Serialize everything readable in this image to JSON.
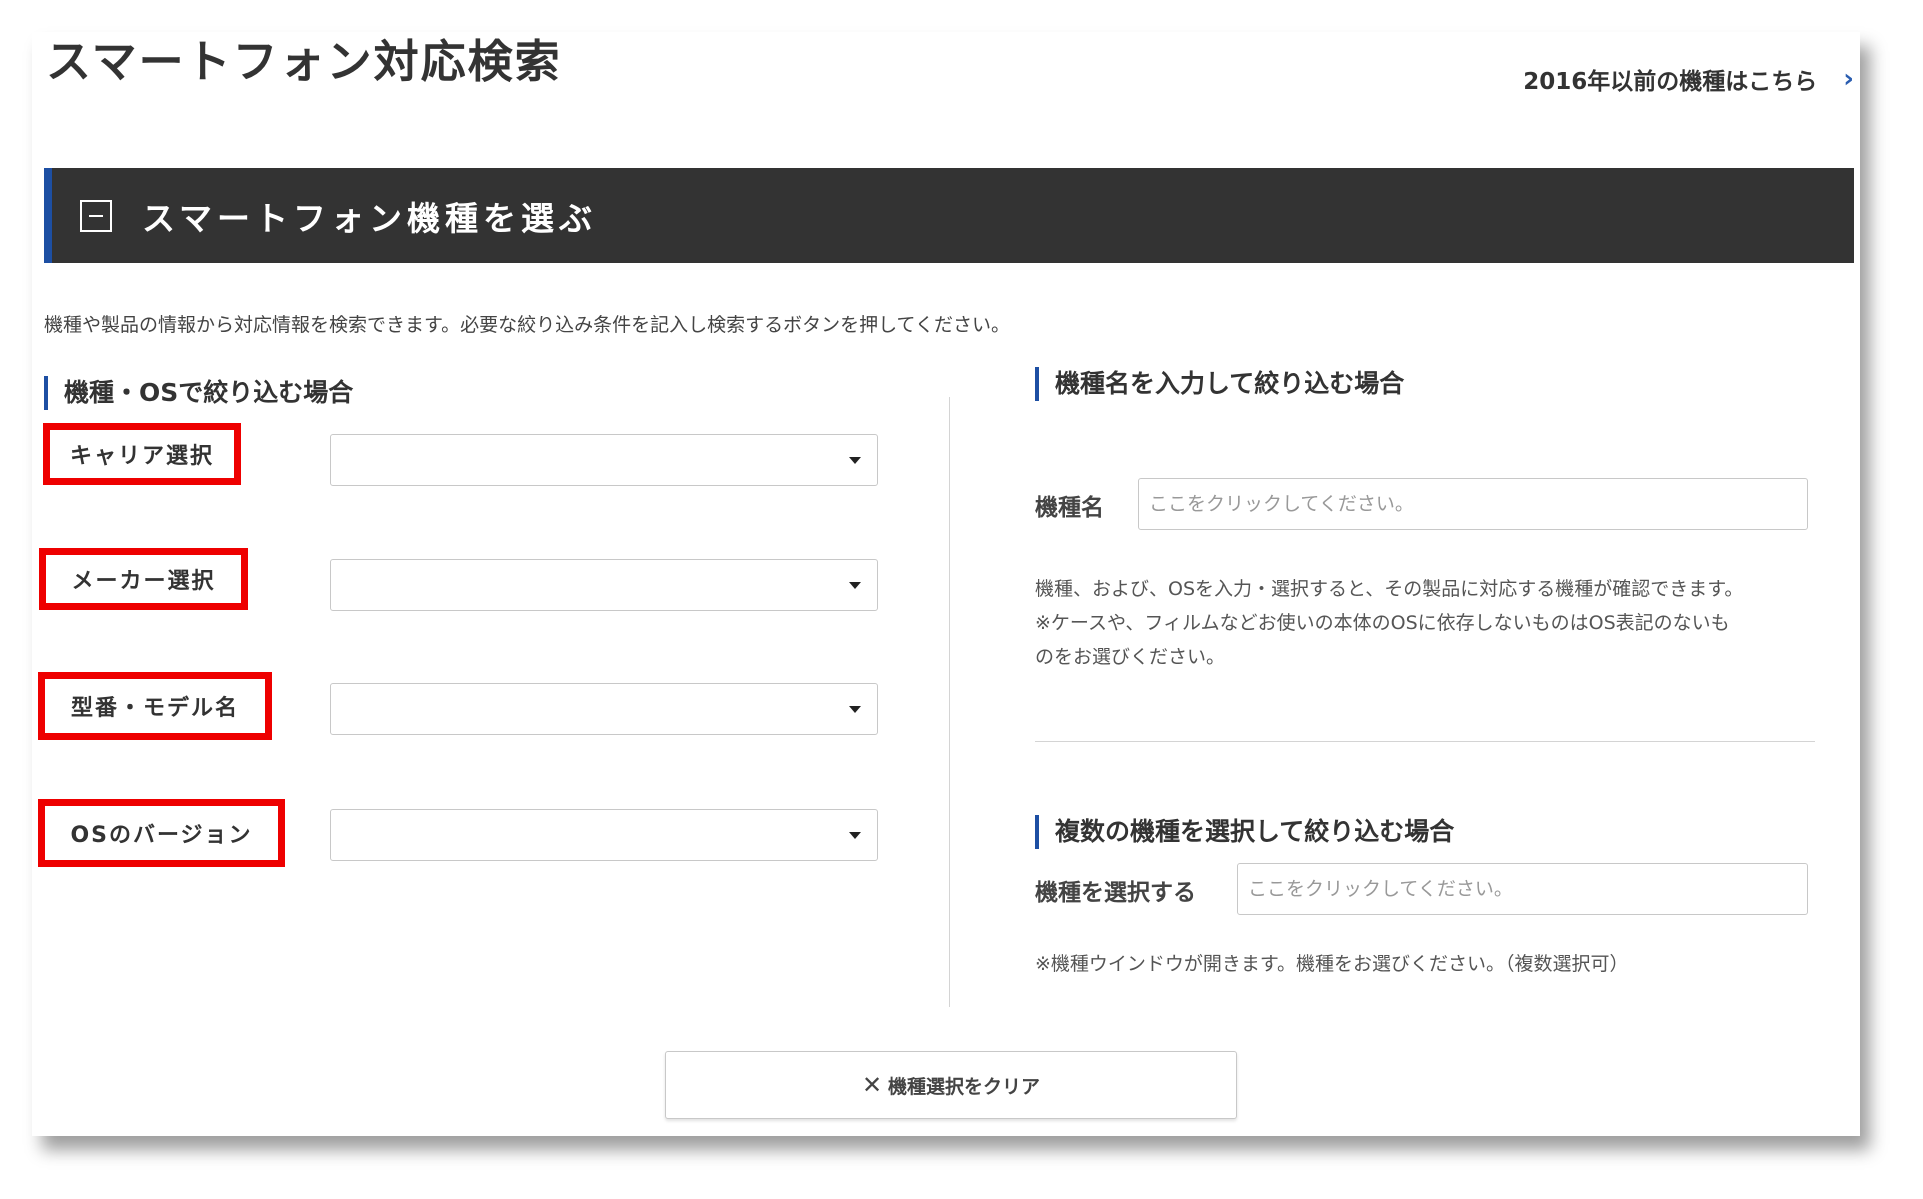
{
  "header": {
    "page_title": "スマートフォン対応検索",
    "older_link": "2016年以前の機種はこちら",
    "older_link_icon": "chevron-right-icon"
  },
  "section": {
    "title": "スマートフォン機種を選ぶ",
    "collapse_icon": "minus-square-icon",
    "intro": "機種や製品の情報から対応情報を検索できます。必要な絞り込み条件を記入し検索するボタンを押してください。"
  },
  "left_panel": {
    "heading": "機種・OSで絞り込む場合",
    "fields": [
      {
        "label": "キャリア選択",
        "value": ""
      },
      {
        "label": "メーカー選択",
        "value": ""
      },
      {
        "label": "型番・モデル名",
        "value": ""
      },
      {
        "label": "OSのバージョン",
        "value": ""
      }
    ]
  },
  "right_panel": {
    "name_search": {
      "heading": "機種名を入力して絞り込む場合",
      "label": "機種名",
      "placeholder": "ここをクリックしてください。",
      "note_lines": [
        "機種、および、OSを入力・選択すると、その製品に対応する機種が確認できます。",
        "※ケースや、フィルムなどお使いの本体のOSに依存しないものはOS表記のないも",
        "のをお選びください。"
      ]
    },
    "multi_select": {
      "heading": "複数の機種を選択して絞り込む場合",
      "label": "機種を選択する",
      "placeholder": "ここをクリックしてください。",
      "note": "※機種ウインドウが開きます。機種をお選びください。（複数選択可）"
    }
  },
  "clear_button": {
    "icon": "close-icon",
    "label": "機種選択をクリア"
  },
  "colors": {
    "accent_blue": "#1d4fa3",
    "bar_bg": "#333333",
    "highlight_red": "#ee0000"
  }
}
